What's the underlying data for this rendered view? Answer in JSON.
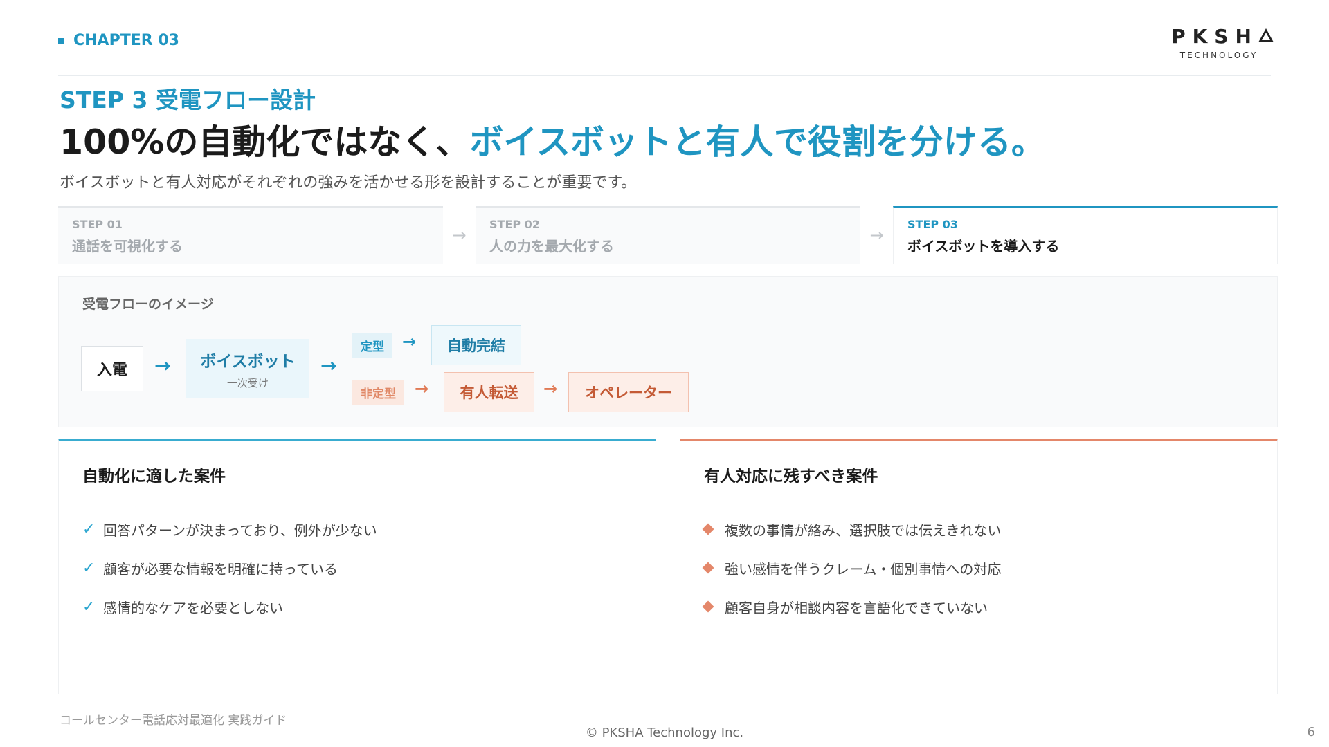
{
  "header": {
    "chapter": "CHAPTER 03",
    "logo_main": "PKSH",
    "logo_sub": "TECHNOLOGY"
  },
  "step_heading": "STEP 3 受電フロー設計",
  "headline": {
    "plain": "100%の自動化ではなく、",
    "accent": "ボイスボットと有人で役割を分ける。"
  },
  "lead": "ボイスボットと有人対応がそれぞれの強みを活かせる形を設計することが重要です。",
  "steps": [
    {
      "num": "STEP 01",
      "title": "通話を可視化する"
    },
    {
      "num": "STEP 02",
      "title": "人の力を最大化する"
    },
    {
      "num": "STEP 03",
      "title": "ボイスボットを導入する"
    }
  ],
  "step_arrow": "→",
  "flow": {
    "caption": "受電フローのイメージ",
    "incoming": "入電",
    "bot": "ボイスボット",
    "bot_sub": "一次受け",
    "tag_fixed": "定型",
    "auto_complete": "自動完結",
    "tag_nonfixed": "非定型",
    "human_transfer": "有人転送",
    "operator": "オペレーター",
    "arrow": "→"
  },
  "cards": {
    "left": {
      "title": "自動化に適した案件",
      "mark": "✓",
      "items": [
        "回答パターンが決まっており、例外が少ない",
        "顧客が必要な情報を明確に持っている",
        "感情的なケアを必要としない"
      ]
    },
    "right": {
      "title": "有人対応に残すべき案件",
      "items": [
        "複数の事情が絡み、選択肢では伝えきれない",
        "強い感情を伴うクレーム・個別事情への対応",
        "顧客自身が相談内容を言語化できていない"
      ]
    }
  },
  "footer": {
    "doc_title": "コールセンター電話応対最適化 実践ガイド",
    "copyright": "© PKSHA Technology Inc.",
    "page": "6"
  },
  "colors": {
    "accent_blue": "#1f95c1",
    "accent_orange": "#e4876a"
  }
}
